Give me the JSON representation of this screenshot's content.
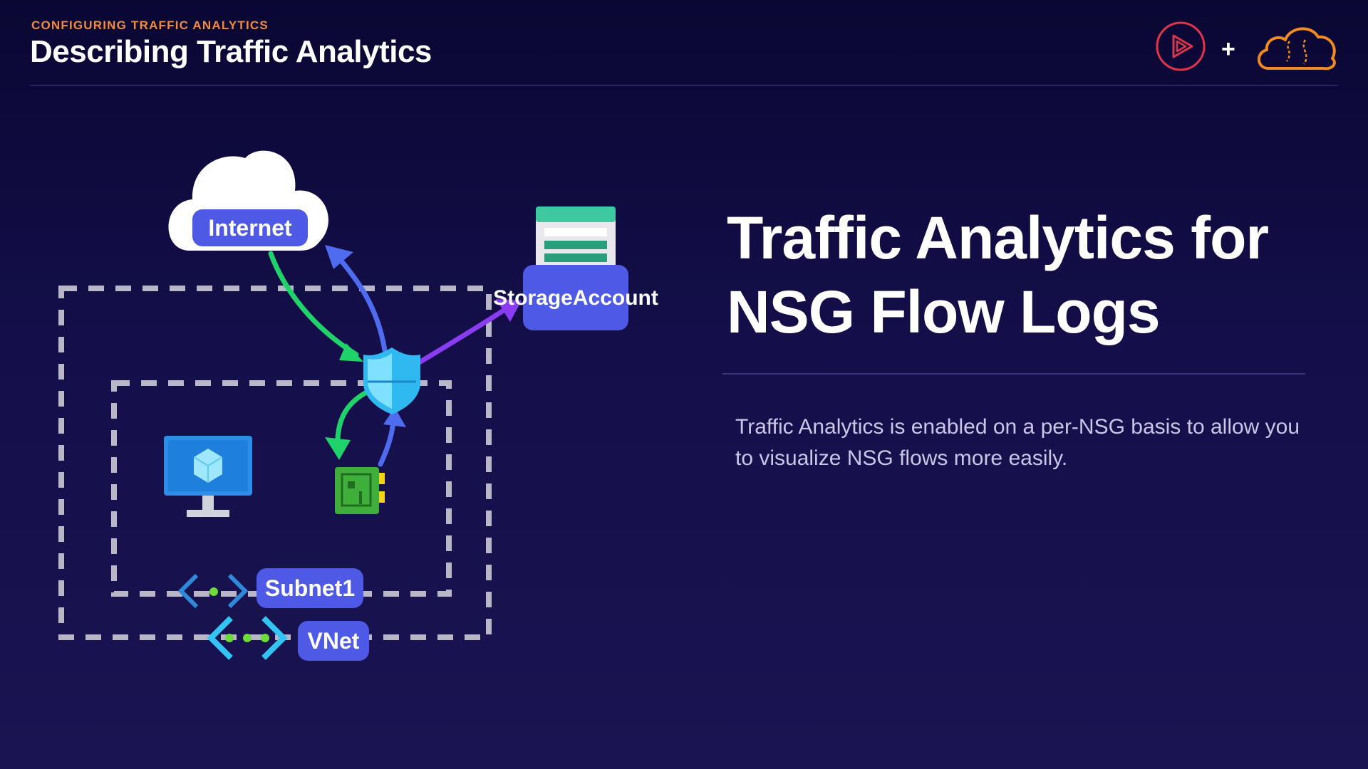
{
  "header": {
    "eyebrow": "CONFIGURING TRAFFIC ANALYTICS",
    "title": "Describing Traffic Analytics"
  },
  "brand": {
    "logo1": "play-icon",
    "separator": "+",
    "logo2": "cloud-icon",
    "colors": {
      "pluralsight": "#e0344a",
      "cloud": "#f08a24"
    }
  },
  "main": {
    "title": "Traffic Analytics for NSG Flow Logs",
    "description": "Traffic Analytics is enabled on a per-NSG basis to allow you to visualize NSG flows more easily."
  },
  "diagram": {
    "internet_label": "Internet",
    "storage_label_line1": "Storage",
    "storage_label_line2": "Account",
    "subnet_label": "Subnet1",
    "vnet_label": "VNet",
    "icons": [
      "cloud-icon",
      "storage-icon",
      "shield-icon",
      "monitor-icon",
      "nic-icon",
      "subnet-icon",
      "vnet-icon"
    ],
    "colors": {
      "label_bg": "#4e5ae6",
      "arrow_green": "#1fd36a",
      "arrow_blue": "#4f6cf0",
      "arrow_purple": "#8a3cf0",
      "dash": "#b9b6c8"
    }
  }
}
